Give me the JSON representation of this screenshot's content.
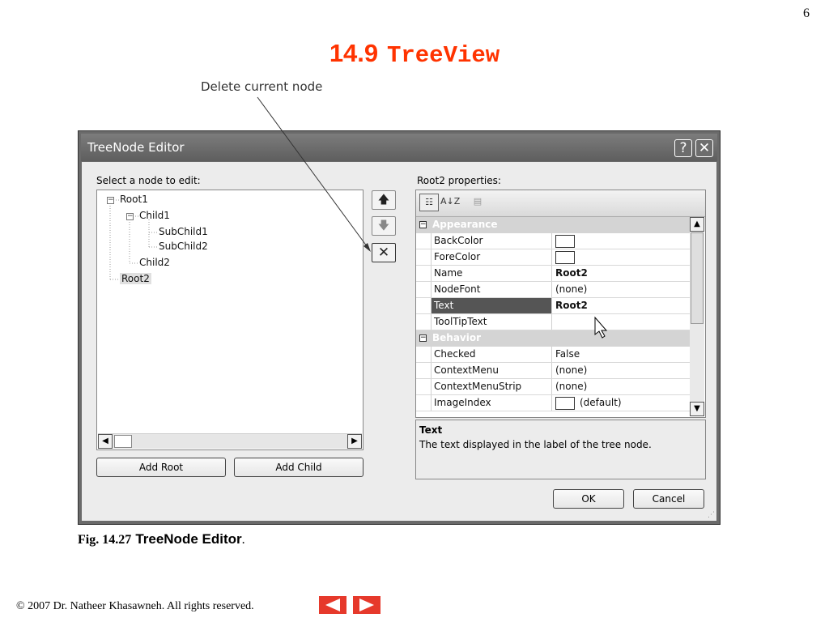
{
  "slide": {
    "page_number": "6",
    "title_number": "14.9",
    "title_code": "TreeView",
    "callout": "Delete current node",
    "caption_fig": "Fig. 14.27",
    "caption_name": "TreeNode Editor",
    "caption_dot": ".",
    "footer": "© 2007 Dr. Natheer Khasawneh.  All rights reserved.",
    "title_color": "#ff3300",
    "nav_color": "#e6392b"
  },
  "dialog": {
    "title": "TreeNode Editor",
    "help_glyph": "?",
    "close_glyph": "✕",
    "select_label": "Select a node to edit:",
    "tree": [
      {
        "label": "Root1",
        "expander": "−"
      },
      {
        "label": "Child1",
        "expander": "−"
      },
      {
        "label": "SubChild1"
      },
      {
        "label": "SubChild2"
      },
      {
        "label": "Child2"
      },
      {
        "label": "Root2",
        "selected": true
      }
    ],
    "move_up": "🡅",
    "move_down": "🡇",
    "delete_glyph": "✕",
    "scroll_left": "◀",
    "scroll_right": "▶",
    "add_root": "Add Root",
    "add_child": "Add Child",
    "properties_label": "Root2 properties:",
    "toolbar": {
      "categorized": "☷",
      "alphabetical": "A↓Z",
      "property_pages": "▤"
    },
    "categories": [
      {
        "name": "Appearance",
        "expander": "−",
        "rows": [
          {
            "name": "BackColor",
            "value": "",
            "swatch": true
          },
          {
            "name": "ForeColor",
            "value": "",
            "swatch": true
          },
          {
            "name": "Name",
            "value": "Root2",
            "bold": true
          },
          {
            "name": "NodeFont",
            "value": "(none)"
          },
          {
            "name": "Text",
            "value": "Root2",
            "bold": true,
            "highlight": true
          },
          {
            "name": "ToolTipText",
            "value": ""
          }
        ]
      },
      {
        "name": "Behavior",
        "expander": "−",
        "rows": [
          {
            "name": "Checked",
            "value": "False"
          },
          {
            "name": "ContextMenu",
            "value": "(none)"
          },
          {
            "name": "ContextMenuStrip",
            "value": "(none)"
          },
          {
            "name": "ImageIndex",
            "value": "(default)",
            "swatch": true
          }
        ]
      }
    ],
    "scroll_up": "▲",
    "scroll_down": "▼",
    "description_title": "Text",
    "description_text": "The text displayed in the label of the tree node.",
    "ok": "OK",
    "cancel": "Cancel"
  }
}
